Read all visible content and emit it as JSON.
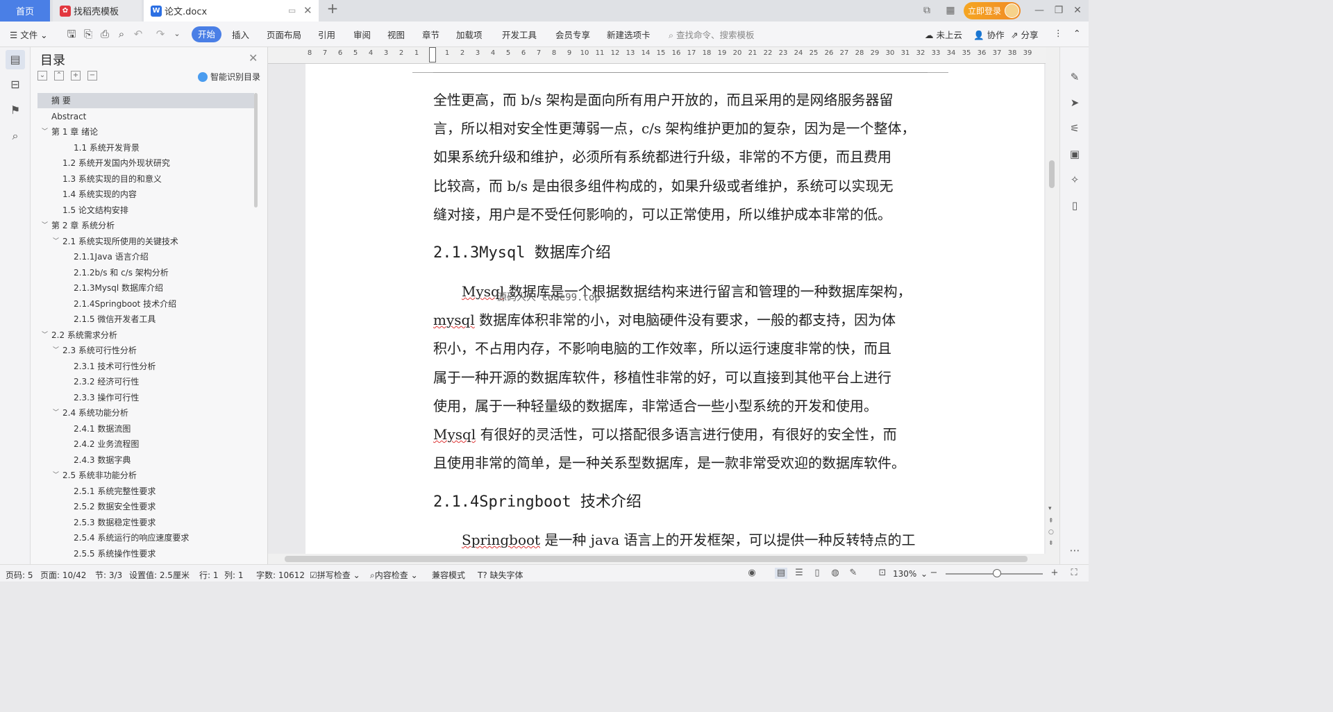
{
  "tabs": {
    "home": "首页",
    "template": "找稻壳模板",
    "doc": "论文.docx",
    "doc_icon": "W"
  },
  "titlebar": {
    "login": "立即登录"
  },
  "menu": {
    "file": "文件",
    "items": [
      "开始",
      "插入",
      "页面布局",
      "引用",
      "审阅",
      "视图",
      "章节",
      "加载项",
      "开发工具",
      "会员专享",
      "新建选项卡"
    ],
    "search_placeholder": "查找命令、搜索模板",
    "cloud": "未上云",
    "collab": "协作",
    "share": "分享"
  },
  "toc": {
    "title": "目录",
    "smart": "智能识别目录",
    "items": [
      {
        "label": "摘    要",
        "level": 0,
        "arrow": false,
        "selected": true
      },
      {
        "label": "Abstract",
        "level": 0,
        "arrow": false
      },
      {
        "label": "第 1 章   绪论",
        "level": 0,
        "arrow": true
      },
      {
        "label": "1.1 系统开发背景",
        "level": 2,
        "arrow": false
      },
      {
        "label": "1.2 系统开发国内外现状研究",
        "level": 1,
        "arrow": false
      },
      {
        "label": "1.3 系统实现的目的和意义",
        "level": 1,
        "arrow": false
      },
      {
        "label": "1.4 系统实现的内容",
        "level": 1,
        "arrow": false
      },
      {
        "label": "1.5 论文结构安排",
        "level": 1,
        "arrow": false
      },
      {
        "label": "第 2 章   系统分析",
        "level": 0,
        "arrow": true
      },
      {
        "label": "2.1 系统实现所使用的关键技术",
        "level": 1,
        "arrow": true
      },
      {
        "label": "2.1.1Java 语言介绍",
        "level": 2,
        "arrow": false
      },
      {
        "label": "2.1.2b/s 和 c/s 架构分析",
        "level": 2,
        "arrow": false
      },
      {
        "label": "2.1.3Mysql 数据库介绍",
        "level": 2,
        "arrow": false
      },
      {
        "label": "2.1.4Springboot 技术介绍",
        "level": 2,
        "arrow": false
      },
      {
        "label": "2.1.5 微信开发者工具",
        "level": 2,
        "arrow": false
      },
      {
        "label": "2.2 系统需求分析",
        "level": 0,
        "arrow": true
      },
      {
        "label": "2.3 系统可行性分析",
        "level": 1,
        "arrow": true
      },
      {
        "label": "2.3.1 技术可行性分析",
        "level": 2,
        "arrow": false
      },
      {
        "label": "2.3.2 经济可行性",
        "level": 2,
        "arrow": false
      },
      {
        "label": "2.3.3 操作可行性",
        "level": 2,
        "arrow": false
      },
      {
        "label": "2.4 系统功能分析",
        "level": 1,
        "arrow": true
      },
      {
        "label": "2.4.1 数据流图",
        "level": 2,
        "arrow": false
      },
      {
        "label": "2.4.2  业务流程图",
        "level": 2,
        "arrow": false
      },
      {
        "label": "2.4.3 数据字典",
        "level": 2,
        "arrow": false
      },
      {
        "label": "2.5  系统非功能分析",
        "level": 1,
        "arrow": true
      },
      {
        "label": "2.5.1 系统完整性要求",
        "level": 2,
        "arrow": false
      },
      {
        "label": "2.5.2 数据安全性要求",
        "level": 2,
        "arrow": false
      },
      {
        "label": "2.5.3 数据稳定性要求",
        "level": 2,
        "arrow": false
      },
      {
        "label": "2.5.4 系统运行的响应速度要求",
        "level": 2,
        "arrow": false
      },
      {
        "label": "2.5.5 系统操作性要求",
        "level": 2,
        "arrow": false
      }
    ]
  },
  "ruler": [
    "8",
    "7",
    "6",
    "5",
    "4",
    "3",
    "2",
    "1",
    "",
    "1",
    "2",
    "3",
    "4",
    "5",
    "6",
    "7",
    "8",
    "9",
    "10",
    "11",
    "12",
    "13",
    "14",
    "15",
    "16",
    "17",
    "18",
    "19",
    "20",
    "21",
    "22",
    "23",
    "24",
    "25",
    "26",
    "27",
    "28",
    "29",
    "30",
    "31",
    "32",
    "33",
    "34",
    "35",
    "36",
    "37",
    "38",
    "39"
  ],
  "doc": {
    "p1": [
      "全性更高，而 b/s 架构是面向所有用户开放的，而且采用的是网络服务器留",
      "言，所以相对安全性更薄弱一点，c/s 架构维护更加的复杂，因为是一个整体，",
      "如果系统升级和维护，必须所有系统都进行升级，非常的不方便，而且费用",
      "比较高，而 b/s 是由很多组件构成的，如果升级或者维护，系统可以实现无",
      "缝对接，用户是不受任何影响的，可以正常使用，所以维护成本非常的低。"
    ],
    "h1": "2.1.3Mysql 数据库介绍",
    "p2_first_word": "Mysql",
    "p2_first_rest": " 数据库是一个根据数据结构来进行留言和管理的一种数据库架构，",
    "p2_second_word": "mysql",
    "p2_second_rest": " 数据库体积非常的小，对电脑硬件没有要求，一般的都支持，因为体",
    "p2": [
      "积小，不占用内存，不影响电脑的工作效率，所以运行速度非常的快，而且",
      "属于一种开源的数据库软件，移植性非常的好，可以直接到其他平台上进行",
      "使用，属于一种轻量级的数据库，非常适合一些小型系统的开发和使用。"
    ],
    "p2_mysql_word": "Mysql",
    "p2_mysql_rest": " 有很好的灵活性，可以搭配很多语言进行使用，有很好的安全性，而",
    "p2_last": "且使用非常的简单，是一种关系型数据库，是一款非常受欢迎的数据库软件。",
    "h2": "2.1.4Springboot 技术介绍",
    "p3_word": "Springboot",
    "p3_rest": " 是一种 java 语言上的开发框架，可以提供一种反转特点的工",
    "watermark": "源码人人 code99.top"
  },
  "status": {
    "page": "页码: 5",
    "pages": "页面: 10/42",
    "section": "节: 3/3",
    "setting": "设置值: 2.5厘米",
    "row": "行: 1",
    "col": "列: 1",
    "words": "字数: 10612",
    "spell": "拼写检查",
    "content": "内容检查",
    "compat": "兼容模式",
    "missing_font": "缺失字体",
    "zoom": "130%"
  }
}
